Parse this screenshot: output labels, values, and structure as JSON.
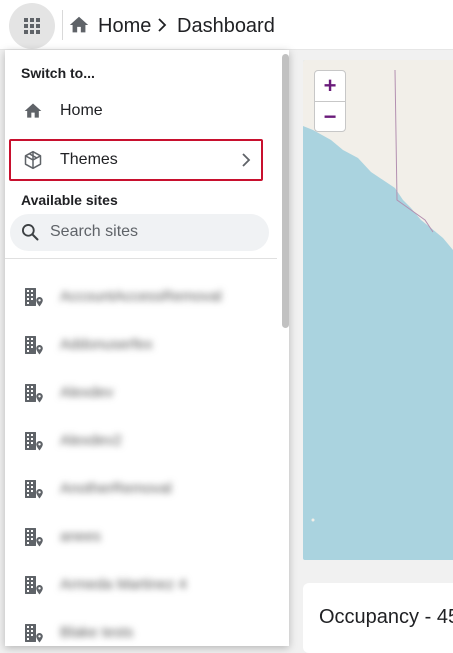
{
  "topbar": {
    "crumbs": [
      "Home",
      "Dashboard"
    ]
  },
  "switcher": {
    "switch_to_label": "Switch to...",
    "items": [
      {
        "label": "Home",
        "icon": "home-icon"
      },
      {
        "label": "Themes",
        "icon": "themes-icon",
        "has_submenu": true,
        "highlighted": true
      }
    ],
    "available_sites_label": "Available sites",
    "search": {
      "placeholder": "Search sites",
      "value": ""
    },
    "sites": [
      {
        "name": "AccountAccessRemoval",
        "icon": "building-icon"
      },
      {
        "name": "Addonuserfex",
        "icon": "building-icon"
      },
      {
        "name": "Alexdev",
        "icon": "building-icon"
      },
      {
        "name": "Alexdev2",
        "icon": "building-icon"
      },
      {
        "name": "AnotherRemoval",
        "icon": "building-icon"
      },
      {
        "name": "anees",
        "icon": "building-icon"
      },
      {
        "name": "Armeda Martinez 4",
        "icon": "building-icon"
      },
      {
        "name": "Blake tests",
        "icon": "building-icon"
      }
    ]
  },
  "map": {
    "zoom_in": "+",
    "zoom_out": "−"
  },
  "card": {
    "title": "Occupancy - 45"
  },
  "colors": {
    "highlight_border": "#c8102e",
    "map_water": "#aad3df",
    "map_land": "#f2efe9",
    "zoom_accent": "#6a1b7a"
  }
}
